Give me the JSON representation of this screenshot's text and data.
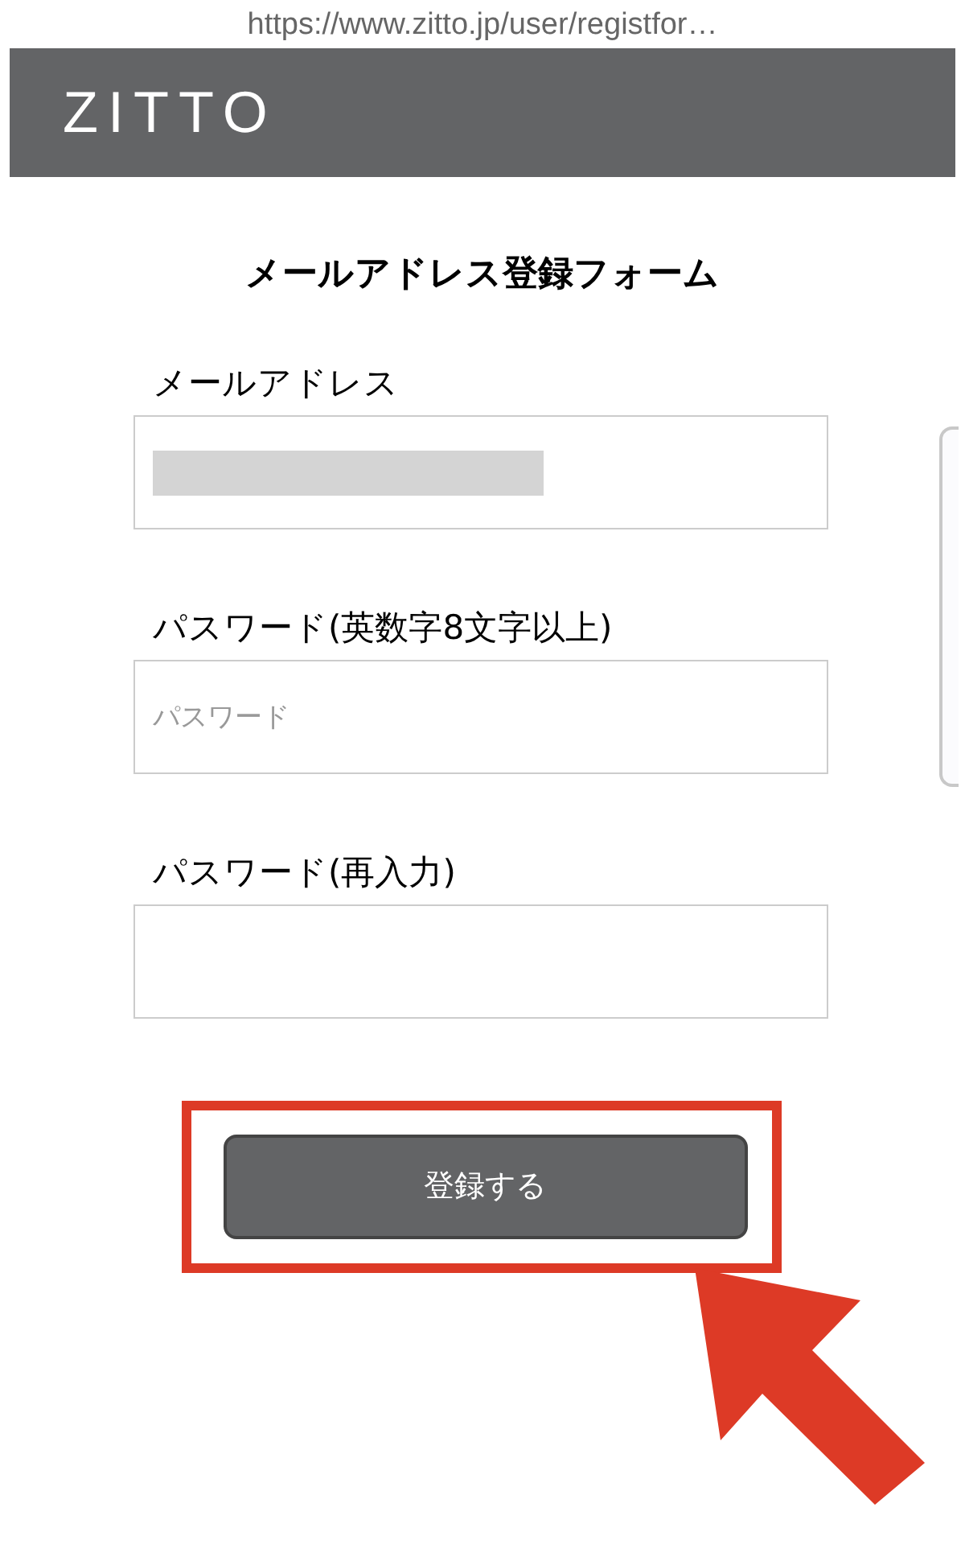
{
  "address_bar": {
    "url": "https://www.zitto.jp/user/registfor…"
  },
  "header": {
    "logo": "ZITTO"
  },
  "form": {
    "title": "メールアドレス登録フォーム",
    "fields": [
      {
        "label": "メールアドレス",
        "redacted": true
      },
      {
        "label": "パスワード(英数字8文字以上)",
        "placeholder": "パスワード",
        "redacted": false
      },
      {
        "label": "パスワード(再入力)",
        "redacted": false
      }
    ],
    "submit_button": "登録する"
  }
}
